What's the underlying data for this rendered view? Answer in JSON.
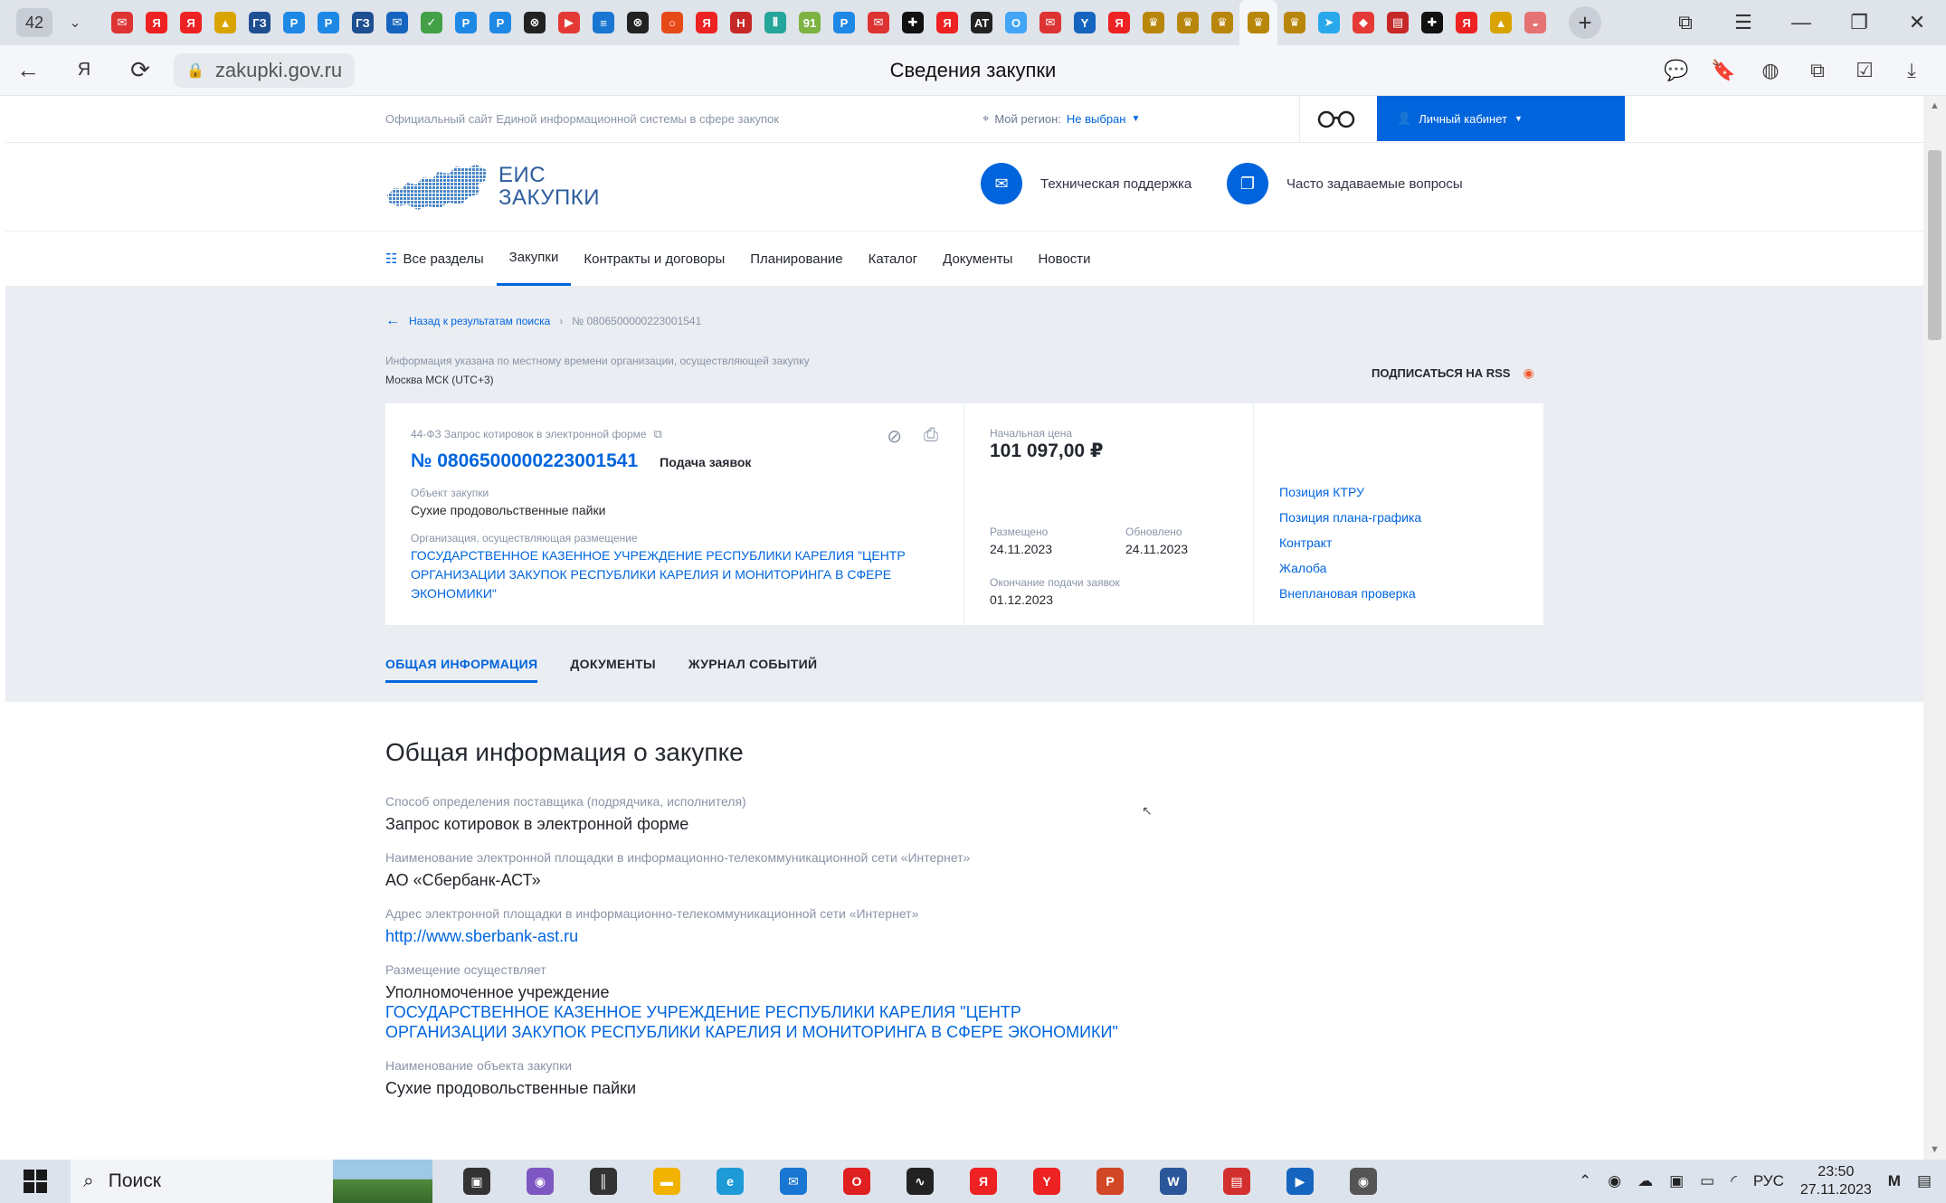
{
  "browser": {
    "tab_count": "42",
    "tab_icons": [
      {
        "name": "tab-icon-1",
        "color": "#d33",
        "glyph": "✉"
      },
      {
        "name": "tab-icon-yandex-1",
        "color": "#e22",
        "glyph": "Я"
      },
      {
        "name": "tab-icon-yandex-2",
        "color": "#e22",
        "glyph": "Я"
      },
      {
        "name": "tab-icon-4",
        "color": "#d9a400",
        "glyph": "▲"
      },
      {
        "name": "tab-icon-gz-1",
        "color": "#1d4f91",
        "glyph": "ГЗ"
      },
      {
        "name": "tab-icon-6",
        "color": "#1e88e5",
        "glyph": "Р"
      },
      {
        "name": "tab-icon-7",
        "color": "#1e88e5",
        "glyph": "Р"
      },
      {
        "name": "tab-icon-gz-2",
        "color": "#1d4f91",
        "glyph": "ГЗ"
      },
      {
        "name": "tab-icon-mail",
        "color": "#1565c0",
        "glyph": "✉"
      },
      {
        "name": "tab-icon-10",
        "color": "#43a047",
        "glyph": "✓"
      },
      {
        "name": "tab-icon-11",
        "color": "#1e88e5",
        "glyph": "Р"
      },
      {
        "name": "tab-icon-12",
        "color": "#1e88e5",
        "glyph": "Р"
      },
      {
        "name": "tab-icon-13",
        "color": "#222",
        "glyph": "⊗"
      },
      {
        "name": "tab-icon-youtube",
        "color": "#e53935",
        "glyph": "▶"
      },
      {
        "name": "tab-icon-15",
        "color": "#1976d2",
        "glyph": "≡"
      },
      {
        "name": "tab-icon-16",
        "color": "#222",
        "glyph": "⊗"
      },
      {
        "name": "tab-icon-17",
        "color": "#e64a19",
        "glyph": "○"
      },
      {
        "name": "tab-icon-yandex-3",
        "color": "#e22",
        "glyph": "Я"
      },
      {
        "name": "tab-icon-19",
        "color": "#c62828",
        "glyph": "Н"
      },
      {
        "name": "tab-icon-20",
        "color": "#26a69a",
        "glyph": "⫴"
      },
      {
        "name": "tab-icon-21",
        "color": "#7cb342",
        "glyph": "91"
      },
      {
        "name": "tab-icon-22",
        "color": "#1e88e5",
        "glyph": "Р"
      },
      {
        "name": "tab-icon-23",
        "color": "#d33",
        "glyph": "✉"
      },
      {
        "name": "tab-icon-24",
        "color": "#111",
        "glyph": "✚"
      },
      {
        "name": "tab-icon-yandex-4",
        "color": "#e22",
        "glyph": "Я"
      },
      {
        "name": "tab-icon-26",
        "color": "#222",
        "glyph": "AT"
      },
      {
        "name": "tab-icon-27",
        "color": "#42a5f5",
        "glyph": "O"
      },
      {
        "name": "tab-icon-28",
        "color": "#d33",
        "glyph": "✉"
      },
      {
        "name": "tab-icon-29",
        "color": "#1565c0",
        "glyph": "Y"
      },
      {
        "name": "tab-icon-yandex-5",
        "color": "#e22",
        "glyph": "Я"
      },
      {
        "name": "tab-icon-emblem-1",
        "color": "#b8860b",
        "glyph": "♛"
      },
      {
        "name": "tab-icon-emblem-2",
        "color": "#b8860b",
        "glyph": "♛"
      },
      {
        "name": "tab-icon-emblem-3",
        "color": "#b8860b",
        "glyph": "♛"
      },
      {
        "name": "tab-icon-emblem-active",
        "color": "#b8860b",
        "glyph": "♛",
        "active": true
      },
      {
        "name": "tab-icon-emblem-5",
        "color": "#b8860b",
        "glyph": "♛"
      },
      {
        "name": "tab-icon-telegram",
        "color": "#29a9eb",
        "glyph": "➤"
      },
      {
        "name": "tab-icon-37",
        "color": "#e53935",
        "glyph": "◆"
      },
      {
        "name": "tab-icon-38",
        "color": "#c62828",
        "glyph": "▤"
      },
      {
        "name": "tab-icon-39",
        "color": "#111",
        "glyph": "✚"
      },
      {
        "name": "tab-icon-yandex-6",
        "color": "#e22",
        "glyph": "Я"
      },
      {
        "name": "tab-icon-41",
        "color": "#d9a400",
        "glyph": "▲"
      },
      {
        "name": "tab-icon-42",
        "color": "#e57373",
        "glyph": "◒"
      }
    ],
    "url": "zakupki.gov.ru",
    "page_title": "Сведения закупки"
  },
  "site": {
    "official_text": "Официальный сайт Единой информационной системы в сфере закупок",
    "region_label": "Мой регион:",
    "region_value": "Не выбран",
    "cabinet_label": "Личный кабинет",
    "logo_line1": "ЕИС",
    "logo_line2": "ЗАКУПКИ",
    "support_label": "Техническая поддержка",
    "faq_label": "Часто задаваемые вопросы",
    "nav": [
      {
        "label": "Все разделы",
        "active": false
      },
      {
        "label": "Закупки",
        "active": true
      },
      {
        "label": "Контракты и договоры",
        "active": false
      },
      {
        "label": "Планирование",
        "active": false
      },
      {
        "label": "Каталог",
        "active": false
      },
      {
        "label": "Документы",
        "active": false
      },
      {
        "label": "Новости",
        "active": false
      }
    ]
  },
  "breadcrumbs": {
    "back": "Назад к результатам поиска",
    "current": "№ 0806500000223001541"
  },
  "tz": {
    "note": "Информация указана по местному времени организации, осуществляющей закупку",
    "value": "Москва МСК (UTC+3)"
  },
  "rss_label": "ПОДПИСАТЬСЯ НА RSS",
  "card": {
    "law_type": "44-ФЗ Запрос котировок в электронной форме",
    "number": "№ 0806500000223001541",
    "stage": "Подача заявок",
    "object_label": "Объект закупки",
    "object_value": "Сухие продовольственные пайки",
    "org_label": "Организация, осуществляющая размещение",
    "org_value": "ГОСУДАРСТВЕННОЕ КАЗЕННОЕ УЧРЕЖДЕНИЕ РЕСПУБЛИКИ КАРЕЛИЯ \"ЦЕНТР ОРГАНИЗАЦИИ ЗАКУПОК РЕСПУБЛИКИ КАРЕЛИЯ И МОНИТОРИНГА В СФЕРЕ ЭКОНОМИКИ\"",
    "price_label": "Начальная цена",
    "price_value": "101 097,00 ₽",
    "placed_label": "Размещено",
    "placed_value": "24.11.2023",
    "updated_label": "Обновлено",
    "updated_value": "24.11.2023",
    "deadline_label": "Окончание подачи заявок",
    "deadline_value": "01.12.2023",
    "links": [
      "Позиция КТРУ",
      "Позиция плана-графика",
      "Контракт",
      "Жалоба",
      "Внеплановая проверка"
    ]
  },
  "tabs": [
    {
      "label": "ОБЩАЯ ИНФОРМАЦИЯ",
      "active": true
    },
    {
      "label": "ДОКУМЕНТЫ",
      "active": false
    },
    {
      "label": "ЖУРНАЛ СОБЫТИЙ",
      "active": false
    }
  ],
  "general": {
    "heading": "Общая информация о закупке",
    "method_label": "Способ определения поставщика (подрядчика, исполнителя)",
    "method_value": "Запрос котировок в электронной форме",
    "platform_label": "Наименование электронной площадки в информационно-телекоммуникационной сети «Интернет»",
    "platform_value": "АО «Сбербанк-АСТ»",
    "address_label": "Адрес электронной площадки в информационно-телекоммуникационной сети «Интернет»",
    "address_value": "http://www.sberbank-ast.ru",
    "placer_label": "Размещение осуществляет",
    "placer_role": "Уполномоченное учреждение",
    "placer_org": "ГОСУДАРСТВЕННОЕ КАЗЕННОЕ УЧРЕЖДЕНИЕ РЕСПУБЛИКИ КАРЕЛИЯ \"ЦЕНТР ОРГАНИЗАЦИИ ЗАКУПОК РЕСПУБЛИКИ КАРЕЛИЯ И МОНИТОРИНГА В СФЕРЕ ЭКОНОМИКИ\"",
    "object_label": "Наименование объекта закупки",
    "object_value": "Сухие продовольственные пайки"
  },
  "taskbar": {
    "search": "Поиск",
    "apps": [
      {
        "name": "task-view-icon",
        "color": "#333",
        "glyph": "▣"
      },
      {
        "name": "app-icon-1",
        "color": "#7e57c2",
        "glyph": "◉"
      },
      {
        "name": "app-separator",
        "color": "#333",
        "glyph": "║"
      },
      {
        "name": "file-explorer-icon",
        "color": "#f2b300",
        "glyph": "▬"
      },
      {
        "name": "edge-icon",
        "color": "#1e9bd7",
        "glyph": "e"
      },
      {
        "name": "mail-icon",
        "color": "#1976d2",
        "glyph": "✉"
      },
      {
        "name": "opera-icon",
        "color": "#e02020",
        "glyph": "O"
      },
      {
        "name": "app-icon-7",
        "color": "#222",
        "glyph": "∿"
      },
      {
        "name": "yandex-icon",
        "color": "#e22",
        "glyph": "Я"
      },
      {
        "name": "yandex-browser-icon",
        "color": "#e22",
        "glyph": "Y"
      },
      {
        "name": "powerpoint-icon",
        "color": "#d24726",
        "glyph": "P"
      },
      {
        "name": "word-icon",
        "color": "#2b579a",
        "glyph": "W"
      },
      {
        "name": "pdf-icon",
        "color": "#d32f2f",
        "glyph": "▤"
      },
      {
        "name": "video-icon",
        "color": "#1565c0",
        "glyph": "▶"
      },
      {
        "name": "record-icon",
        "color": "#555",
        "glyph": "◉"
      }
    ],
    "language": "РУС",
    "time": "23:50",
    "date": "27.11.2023"
  }
}
